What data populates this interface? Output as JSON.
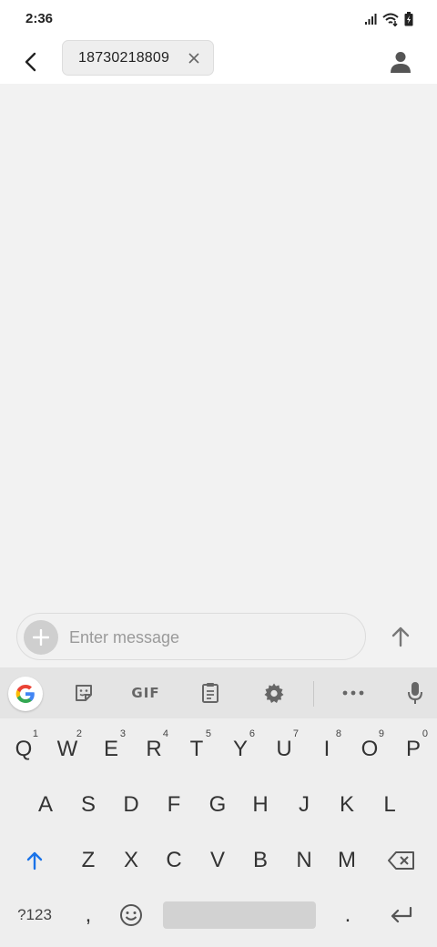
{
  "status_bar": {
    "time": "2:36",
    "icons": [
      "signal-icon",
      "wifi-icon",
      "battery-charging-icon"
    ]
  },
  "app_bar": {
    "recipient": "18730218809",
    "back_icon": "back-arrow-icon",
    "contact_icon": "person-icon"
  },
  "compose": {
    "placeholder": "Enter message",
    "attach_icon": "plus-icon",
    "send_icon": "send-arrow-up-icon"
  },
  "keyboard": {
    "toolbar": [
      "google-icon",
      "sticker-icon",
      "gif-icon",
      "clipboard-icon",
      "settings-icon",
      "more-icon",
      "microphone-icon"
    ],
    "gif_label": "GIF",
    "row1": [
      {
        "k": "Q",
        "n": "1"
      },
      {
        "k": "W",
        "n": "2"
      },
      {
        "k": "E",
        "n": "3"
      },
      {
        "k": "R",
        "n": "4"
      },
      {
        "k": "T",
        "n": "5"
      },
      {
        "k": "Y",
        "n": "6"
      },
      {
        "k": "U",
        "n": "7"
      },
      {
        "k": "I",
        "n": "8"
      },
      {
        "k": "O",
        "n": "9"
      },
      {
        "k": "P",
        "n": "0"
      }
    ],
    "row2": [
      "A",
      "S",
      "D",
      "F",
      "G",
      "H",
      "J",
      "K",
      "L"
    ],
    "row3": [
      "Z",
      "X",
      "C",
      "V",
      "B",
      "N",
      "M"
    ],
    "row4": {
      "symbols": "?123",
      "comma": ",",
      "period": "."
    },
    "accent_color": "#1a73e8"
  }
}
